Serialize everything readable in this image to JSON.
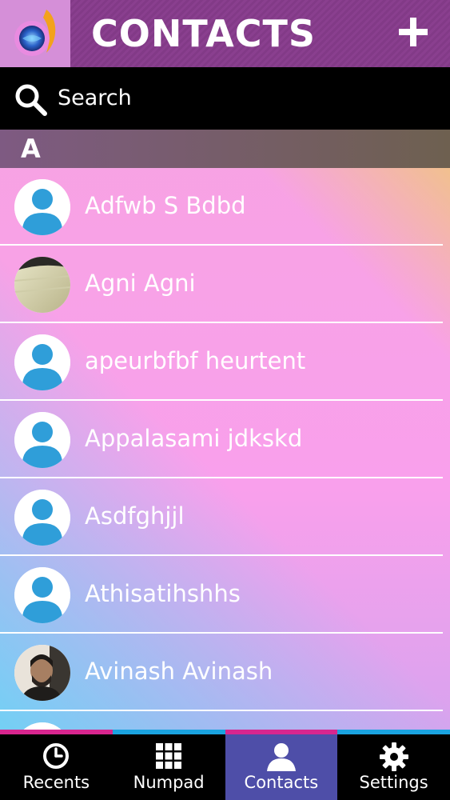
{
  "header": {
    "title": "CONTACTS",
    "add_icon": "plus-icon",
    "logo_icon": "app-logo-icon"
  },
  "search": {
    "placeholder": "Search",
    "icon": "search-icon"
  },
  "section": {
    "letter": "A"
  },
  "contacts": [
    {
      "name": "Adfwb S Bdbd",
      "avatar": "default-avatar"
    },
    {
      "name": "Agni Agni",
      "avatar": "photo-avatar"
    },
    {
      "name": "apeurbfbf heurtent",
      "avatar": "default-avatar"
    },
    {
      "name": "Appalasami jdkskd",
      "avatar": "default-avatar"
    },
    {
      "name": "Asdfghjjl",
      "avatar": "default-avatar"
    },
    {
      "name": "Athisatihshhs",
      "avatar": "default-avatar"
    },
    {
      "name": "Avinash Avinash",
      "avatar": "photo-avatar"
    }
  ],
  "tabs": [
    {
      "label": "Recents",
      "icon": "clock-icon",
      "strip_color": "#d8268f",
      "active": false
    },
    {
      "label": "Numpad",
      "icon": "grid-icon",
      "strip_color": "#1aa3e0",
      "active": false
    },
    {
      "label": "Contacts",
      "icon": "person-icon",
      "strip_color": "#d8268f",
      "active": true
    },
    {
      "label": "Settings",
      "icon": "gear-icon",
      "strip_color": "#1aa3e0",
      "active": false
    }
  ],
  "colors": {
    "header": "#8a3f8f",
    "logo_bg": "#d58fd8",
    "active_tab": "#4e4ea8",
    "avatar_blue": "#2f9ed9"
  }
}
